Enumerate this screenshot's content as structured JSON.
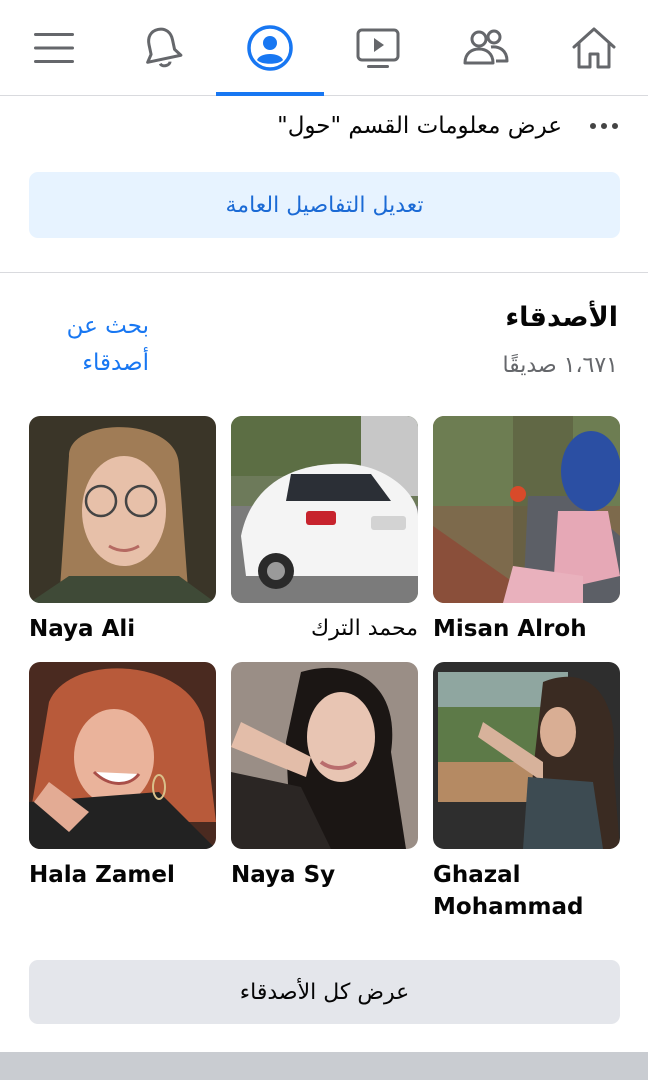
{
  "nav": {
    "items": [
      {
        "icon": "menu-icon"
      },
      {
        "icon": "bell-icon"
      },
      {
        "icon": "profile-icon"
      },
      {
        "icon": "watch-icon"
      },
      {
        "icon": "friends-icon"
      },
      {
        "icon": "home-icon"
      }
    ],
    "active": "profile-icon",
    "accent": "#1877f2"
  },
  "about": {
    "text": "عرض معلومات القسم \"حول\""
  },
  "edit_button": {
    "label": "تعديل التفاصيل العامة",
    "color": "#1b6ad5",
    "background": "#e7f3ff"
  },
  "friends": {
    "title": "الأصدقاء",
    "count": "١،٦٧١ صديقًا",
    "find_line1": "بحث عن",
    "find_line2": "أصدقاء",
    "list": [
      {
        "name": "Misan Alroh"
      },
      {
        "name": "محمد الترك"
      },
      {
        "name": "Naya Ali"
      },
      {
        "name": "Ghazal Mohammad"
      },
      {
        "name": "Naya Sy"
      },
      {
        "name": "Hala Zamel"
      }
    ],
    "see_all": "عرض كل الأصدقاء"
  }
}
